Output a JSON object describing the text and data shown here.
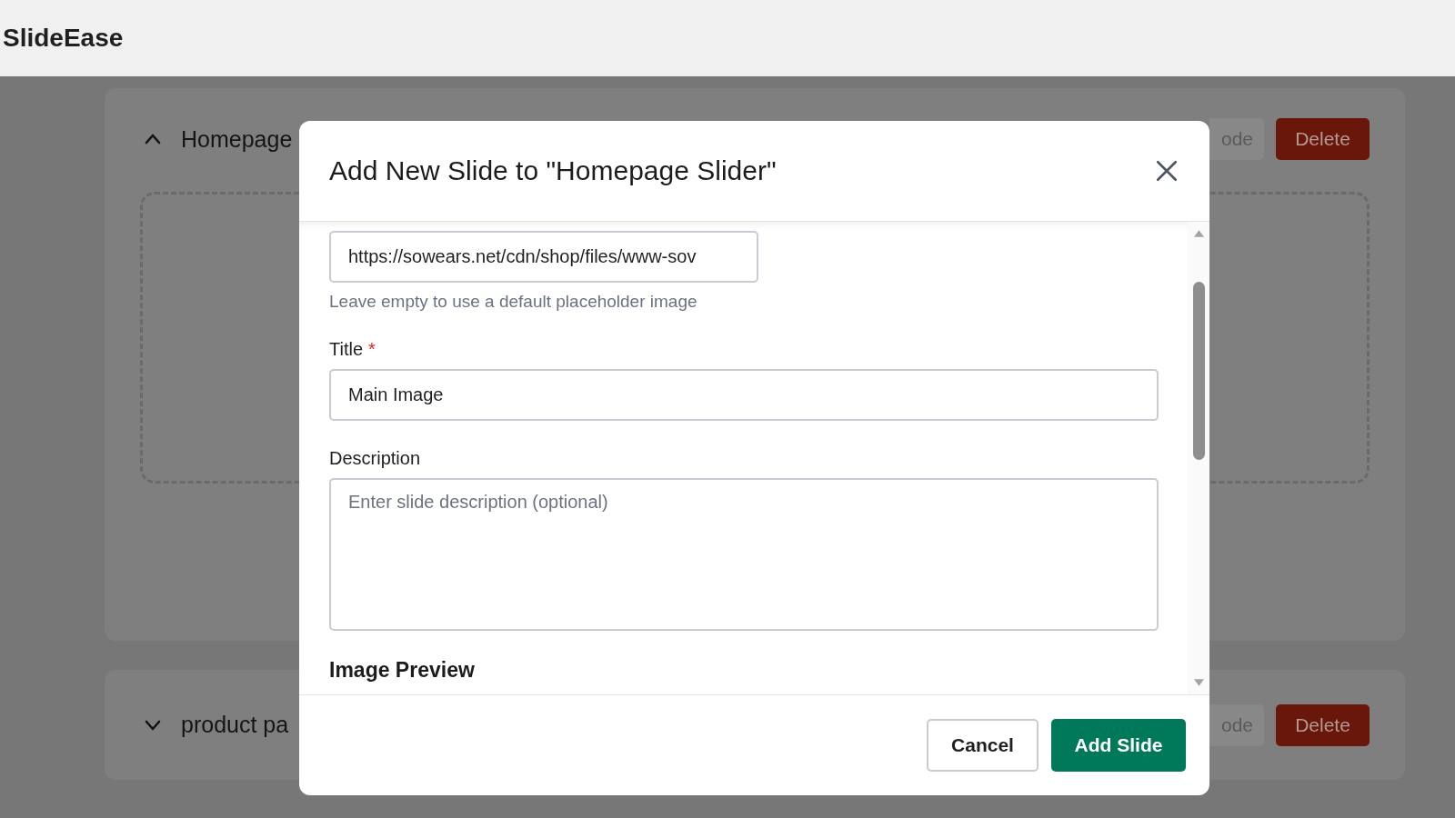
{
  "app": {
    "title": "SlideEase"
  },
  "background_cards": [
    {
      "title": "Homepage",
      "expanded": true,
      "buttons": [
        {
          "label": "ode",
          "kind": "secondary"
        },
        {
          "label": "Delete",
          "kind": "danger"
        }
      ]
    },
    {
      "title": "product pa",
      "expanded": false,
      "buttons": [
        {
          "label": "ode",
          "kind": "secondary"
        },
        {
          "label": "Delete",
          "kind": "danger"
        }
      ]
    }
  ],
  "dialog": {
    "title": "Add New Slide to \"Homepage Slider\"",
    "fields": [
      {
        "kind": "input",
        "value": "https://sowears.net/cdn/shop/files/www-sov",
        "hint": "Leave empty to use a default placeholder image"
      },
      {
        "kind": "input",
        "label": "Title",
        "required_mark": "*",
        "value": "Main Image"
      },
      {
        "kind": "textarea",
        "label": "Description",
        "placeholder": "Enter slide description (optional)"
      }
    ],
    "section_heading": "Image Preview",
    "buttons": [
      {
        "label": "Cancel",
        "kind": "secondary"
      },
      {
        "label": "Add Slide",
        "kind": "primary"
      }
    ]
  }
}
